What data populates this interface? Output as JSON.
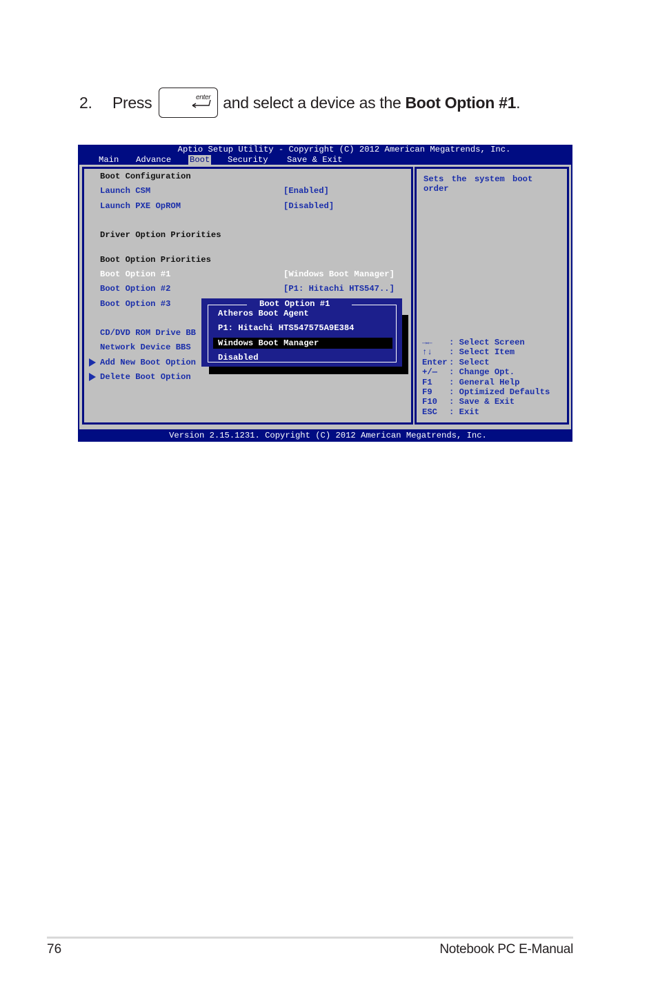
{
  "instruction": {
    "step_number": "2.",
    "text_before": "Press",
    "key_label": "enter",
    "key_icon": "enter-key-icon",
    "text_after": "and select a device as the",
    "emphasis": "Boot Option #1",
    "period": "."
  },
  "bios": {
    "title": "Aptio Setup Utility - Copyright (C) 2012 American Megatrends, Inc.",
    "tabs": [
      {
        "label": "Main",
        "active": false
      },
      {
        "label": "Advance",
        "active": false
      },
      {
        "label": "Boot",
        "active": true
      },
      {
        "label": "Security",
        "active": false
      },
      {
        "label": "Save & Exit",
        "active": false
      }
    ],
    "sections": {
      "boot_configuration": "Boot Configuration",
      "driver_option_priorities": "Driver Option Priorities",
      "boot_option_priorities": "Boot Option Priorities"
    },
    "items": [
      {
        "label": "Launch CSM",
        "value": "[Enabled]"
      },
      {
        "label": "Launch PXE OpROM",
        "value": "[Disabled]"
      },
      {
        "label": "Boot Option #1",
        "value": "[Windows Boot Manager]",
        "selected": true
      },
      {
        "label": "Boot Option #2",
        "value": "[P1: Hitachi HTS547..]"
      },
      {
        "label": "Boot Option #3",
        "value": ""
      },
      {
        "label": "CD/DVD ROM Drive BBS Priorities",
        "visible_label": "CD/DVD ROM Drive BB"
      },
      {
        "label": "Network Device BBS Priorities",
        "visible_label": "Network Device BBS"
      },
      {
        "label": "Add New Boot Option",
        "submenu": true
      },
      {
        "label": "Delete Boot Option",
        "submenu": true
      }
    ],
    "help_text": "Sets the system boot\norder",
    "key_legend": [
      {
        "key": "→←",
        "action": ": Select Screen"
      },
      {
        "key": "↑↓",
        "action": ": Select Item"
      },
      {
        "key": "Enter",
        "action": ": Select"
      },
      {
        "key": "+/—",
        "action": ": Change Opt."
      },
      {
        "key": "F1",
        "action": ": General Help"
      },
      {
        "key": "F9",
        "action": ": Optimized Defaults"
      },
      {
        "key": "F10",
        "action": ": Save & Exit"
      },
      {
        "key": "ESC",
        "action": ": Exit"
      }
    ],
    "popup": {
      "title": "Boot Option #1",
      "options": [
        {
          "label": "Atheros Boot Agent",
          "highlighted": false
        },
        {
          "label": "P1: Hitachi HTS547575A9E384",
          "highlighted": false
        },
        {
          "label": "Windows Boot Manager",
          "highlighted": true
        },
        {
          "label": "Disabled",
          "highlighted": false
        }
      ]
    },
    "footer": "Version 2.15.1231. Copyright (C) 2012 American Megatrends, Inc.",
    "colors": {
      "background_blue": "#000c82",
      "panel_gray": "#c0c0c0",
      "item_blue": "#1a2eaa",
      "popup_blue": "#1c1f8c",
      "highlight_black": "#000000"
    }
  },
  "page": {
    "number": "76",
    "manual_title": "Notebook PC E-Manual"
  }
}
